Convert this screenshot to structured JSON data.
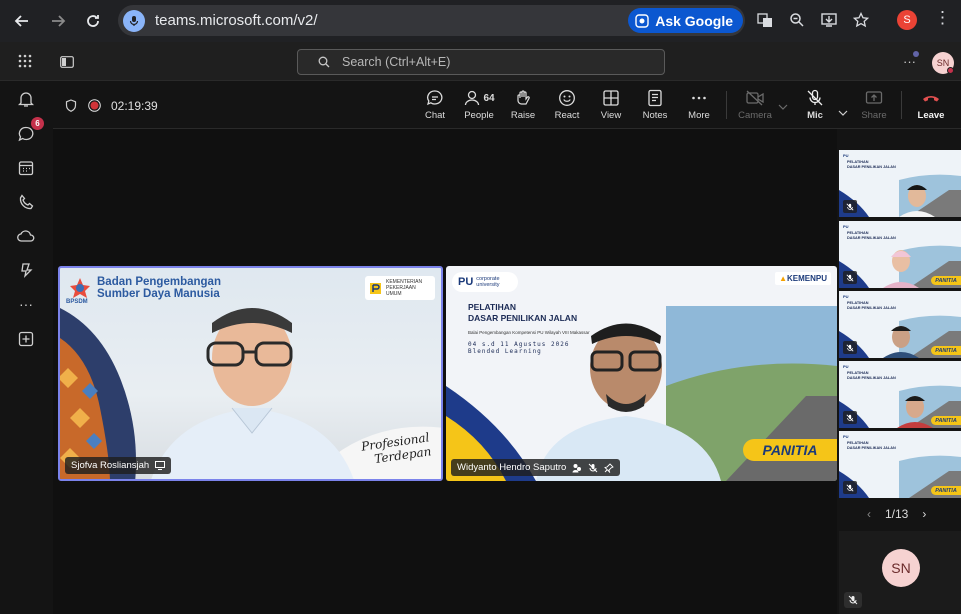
{
  "browser": {
    "url": "teams.microsoft.com/v2/",
    "ask_google": "Ask Google",
    "profile_initial": "S"
  },
  "teams": {
    "search_placeholder": "Search (Ctrl+Alt+E)",
    "avatar": "SN",
    "chat_badge": "6"
  },
  "meeting": {
    "timer": "02:19:39",
    "people_count": "64",
    "tools": {
      "chat": "Chat",
      "people": "People",
      "raise": "Raise",
      "react": "React",
      "view": "View",
      "notes": "Notes",
      "more": "More",
      "camera": "Camera",
      "mic": "Mic",
      "share": "Share",
      "leave": "Leave"
    }
  },
  "participants": {
    "left": {
      "name": "Sjofva Rosliansjah",
      "org_line1": "Badan Pengembangan",
      "org_line2": "Sumber Daya Manusia",
      "org_abbr": "BPSDM",
      "ministry": "KEMENTERIAN PEKERJAAN UMUM",
      "tagline1": "Profesional",
      "tagline2": "Terdepan"
    },
    "right": {
      "name": "Widyanto Hendro Saputro",
      "pu_label": "PU",
      "corporate": "corporate university",
      "title1": "PELATIHAN",
      "title2": "DASAR PENILIKAN JALAN",
      "subtitle": "Balai Pengembangan Kompetensi PU Wilayah VIII Makassar",
      "dates": "04 s.d 11 Agustus 2026",
      "mode": "Blended Learning",
      "kemenpu": "KEMENPU",
      "panitia": "PANITIA"
    }
  },
  "gallery": {
    "page": "1/13",
    "thumb_title1": "PELATIHAN",
    "thumb_title2": "DASAR PENILIKAN JALAN",
    "self_avatar": "SN"
  },
  "colors": {
    "leave": "#e25050",
    "accent": "#7b83eb",
    "brand_blue": "#0b57d0",
    "panitia_yellow": "#f5c518"
  }
}
